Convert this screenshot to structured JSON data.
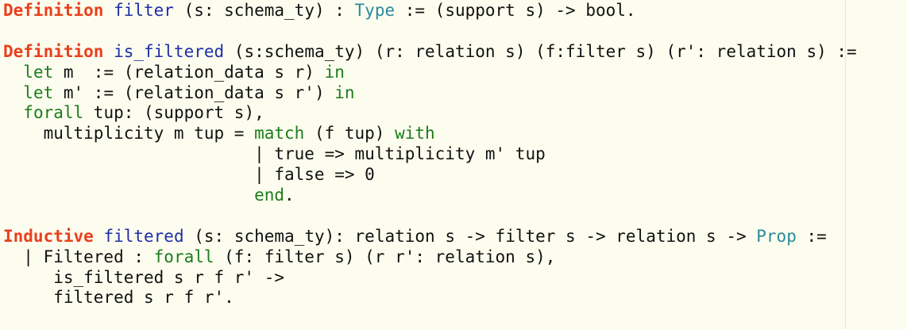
{
  "editor": {
    "lines": [
      [
        {
          "t": "Definition",
          "c": "kw-def"
        },
        {
          "t": " "
        },
        {
          "t": "filter",
          "c": "name"
        },
        {
          "t": " (s: schema_ty) : "
        },
        {
          "t": "Type",
          "c": "type"
        },
        {
          "t": " := (support s) -> bool."
        }
      ],
      [],
      [
        {
          "t": "Definition",
          "c": "kw-def"
        },
        {
          "t": " "
        },
        {
          "t": "is_filtered",
          "c": "name"
        },
        {
          "t": " (s:schema_ty) (r: relation s) (f:filter s) (r': relation s) :="
        }
      ],
      [
        {
          "t": "  "
        },
        {
          "t": "let",
          "c": "tac"
        },
        {
          "t": " m  := (relation_data s r) "
        },
        {
          "t": "in",
          "c": "tac"
        }
      ],
      [
        {
          "t": "  "
        },
        {
          "t": "let",
          "c": "tac"
        },
        {
          "t": " m' := (relation_data s r') "
        },
        {
          "t": "in",
          "c": "tac"
        }
      ],
      [
        {
          "t": "  "
        },
        {
          "t": "forall",
          "c": "tac"
        },
        {
          "t": " tup: (support s),"
        }
      ],
      [
        {
          "t": "    multiplicity m tup = "
        },
        {
          "t": "match",
          "c": "tac"
        },
        {
          "t": " (f tup) "
        },
        {
          "t": "with",
          "c": "tac"
        }
      ],
      [
        {
          "t": "                         | true => multiplicity m' tup"
        }
      ],
      [
        {
          "t": "                         | false => 0"
        }
      ],
      [
        {
          "t": "                         "
        },
        {
          "t": "end",
          "c": "tac"
        },
        {
          "t": "."
        }
      ],
      [],
      [
        {
          "t": "Inductive",
          "c": "kw-def"
        },
        {
          "t": " "
        },
        {
          "t": "filtered",
          "c": "name"
        },
        {
          "t": " (s: schema_ty): relation s -> filter s -> relation s -> "
        },
        {
          "t": "Prop",
          "c": "type"
        },
        {
          "t": " :="
        }
      ],
      [
        {
          "t": "  | Filtered : "
        },
        {
          "t": "forall",
          "c": "tac"
        },
        {
          "t": " (f: filter s) (r r': relation s),"
        }
      ],
      [
        {
          "t": "     is_filtered s r f r' ->"
        }
      ],
      [
        {
          "t": "     filtered s r f r'."
        }
      ]
    ]
  }
}
